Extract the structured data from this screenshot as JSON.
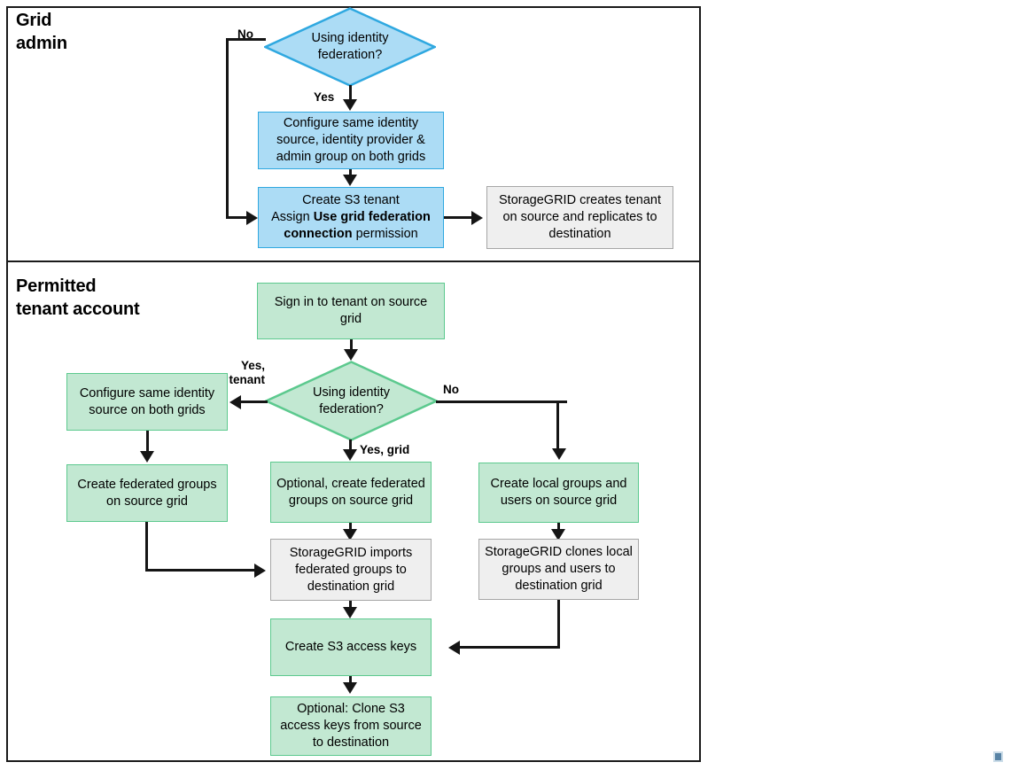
{
  "diagram": {
    "title": "StorageGRID grid federation account clone workflow",
    "colors": {
      "blue_fill": "#ACDCF5",
      "blue_border": "#2FA8E0",
      "green_fill": "#C2E8D2",
      "green_border": "#5CC98E",
      "gray_fill": "#EFEFEF",
      "gray_border": "#A6A6A6",
      "line": "#151515",
      "frame": "#1A1A1A"
    },
    "lanes": [
      {
        "id": "grid-admin",
        "title": "Grid\nadmin"
      },
      {
        "id": "tenant",
        "title": "Permitted\ntenant account"
      }
    ],
    "nodes": {
      "admin_decision": "Using  identity\nfederation?",
      "admin_configure": "Configure same identity source, identity provider & admin group on both grids",
      "admin_create_tenant_line1": "Create S3 tenant",
      "admin_create_tenant_line2_pre": "Assign ",
      "admin_create_tenant_line2_bold": "Use grid federation connection",
      "admin_create_tenant_line2_post": " permission",
      "admin_storagegrid_creates": "StorageGRID creates tenant on source and replicates to destination",
      "tenant_signin": "Sign in to tenant on source grid",
      "tenant_decision": "Using\nidentity\nfederation?",
      "tenant_configure_same_source": "Configure same identity source on both grids",
      "tenant_create_federated_groups": "Create federated groups on source grid",
      "tenant_optional_federated_groups": "Optional, create federated groups on source grid",
      "tenant_create_local_groups": "Create local groups and users on source grid",
      "storagegrid_imports": "StorageGRID imports federated groups to destination grid",
      "storagegrid_clones": "StorageGRID clones local groups and users to destination grid",
      "create_s3_access_keys": "Create S3 access keys",
      "optional_clone_keys": "Optional: Clone S3 access keys from source to destination"
    },
    "edge_labels": {
      "admin_no": "No",
      "admin_yes": "Yes",
      "tenant_yes_tenant": "Yes,\ntenant",
      "tenant_no": "No",
      "tenant_yes_grid": "Yes, grid"
    }
  }
}
